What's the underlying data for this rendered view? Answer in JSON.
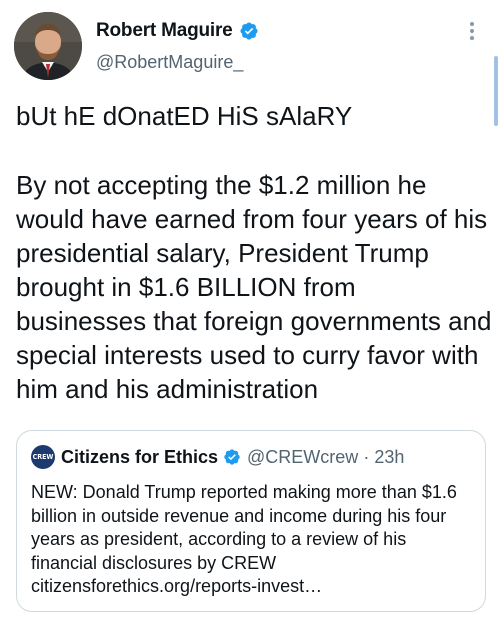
{
  "author": {
    "display_name": "Robert Maguire",
    "handle": "@RobertMaguire_"
  },
  "tweet": {
    "line1": "bUt hE dOnatED HiS sAlaRY",
    "line2": "By not accepting the $1.2 million he would have earned from four years of his presidential salary, President Trump brought in $1.6 BILLION from businesses that foreign governments and special interests used to curry favor with him and his administration"
  },
  "quote": {
    "logo_text": "CREW",
    "display_name": "Citizens for Ethics",
    "handle": "@CREWcrew",
    "separator": "·",
    "time": "23h",
    "text": "NEW: Donald Trump reported making more than $1.6 billion in outside revenue and income during his four years as president, according to a review of his financial disclosures by CREW citizensforethics.org/reports-invest…"
  },
  "colors": {
    "verified_blue": "#1d9bf0",
    "text_primary": "#0f1419",
    "text_secondary": "#536471",
    "border": "#cfd9de"
  },
  "icons": {
    "verified": "verified-badge-icon",
    "more": "more-vertical-icon"
  }
}
